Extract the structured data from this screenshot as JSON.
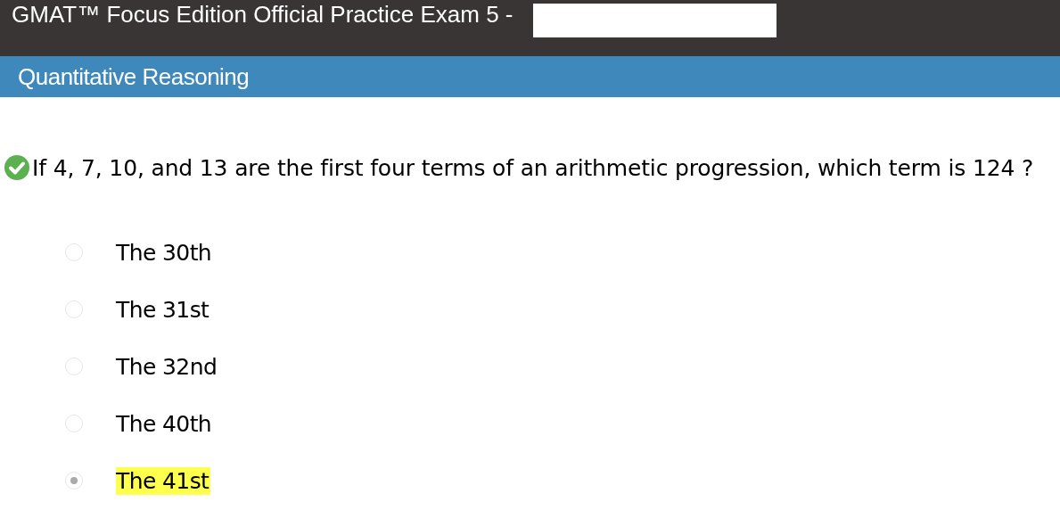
{
  "exam": {
    "title": "GMAT™ Focus Edition Official Practice Exam 5 -"
  },
  "section": {
    "title": "Quantitative Reasoning"
  },
  "question": {
    "correct": true,
    "text": "If 4, 7, 10, and 13 are the first four terms of an arithmetic progression, which term is 124 ?"
  },
  "options": [
    {
      "label": "The 30th",
      "selected": false
    },
    {
      "label": "The 31st",
      "selected": false
    },
    {
      "label": "The 32nd",
      "selected": false
    },
    {
      "label": "The 40th",
      "selected": false
    },
    {
      "label": "The 41st",
      "selected": true
    }
  ]
}
